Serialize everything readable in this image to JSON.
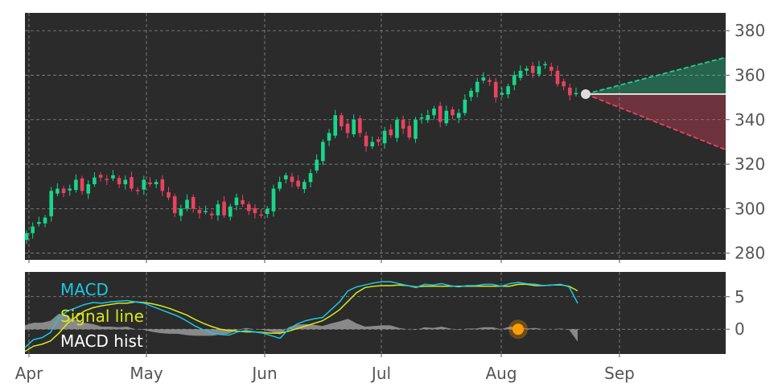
{
  "colors": {
    "background": "#ffffff",
    "panel": "#2b2b2b",
    "grid": "#8a8a8a",
    "up": "#17d68c",
    "down": "#e8435f",
    "macd": "#19c7e6",
    "signal": "#d7e81d",
    "hist": "#9a9a9a",
    "marker": "#ff9c00",
    "projection_up": "#1fcf8f",
    "projection_down": "#e8435f",
    "last_close_dot": "#dddddd",
    "tick_text": "#555555"
  },
  "chart_data": [
    {
      "type": "candlestick",
      "title": "",
      "x_ticks": [
        "Apr",
        "May",
        "Jun",
        "Jul",
        "Aug",
        "Sep"
      ],
      "y_ticks": [
        280,
        300,
        320,
        340,
        360,
        380
      ],
      "ylim": [
        277,
        388
      ],
      "grid": true,
      "y_axis_side": "right",
      "last_close": 351.5,
      "projection": {
        "upper_end": 368,
        "lower_end": 326.5
      },
      "closes": [
        289,
        292,
        294,
        296,
        308,
        309,
        307,
        309,
        313,
        308,
        311,
        314,
        314,
        313,
        315,
        311,
        313,
        309,
        308,
        313,
        311,
        312,
        308,
        305,
        298,
        300,
        304,
        300,
        298,
        299,
        297,
        302,
        297,
        301,
        305,
        302,
        299,
        298,
        297,
        300,
        309,
        312,
        315,
        312,
        310,
        312,
        316,
        322,
        330,
        334,
        342,
        337,
        334,
        340,
        334,
        328,
        330,
        330,
        335,
        333,
        340,
        336,
        332,
        340,
        341,
        342,
        345,
        339,
        344,
        342,
        343,
        349,
        353,
        357,
        359,
        357,
        350,
        352,
        355,
        360,
        362,
        363,
        361,
        364,
        365,
        362,
        356,
        355,
        351,
        352
      ]
    },
    {
      "type": "line",
      "y_ticks": [
        0,
        5
      ],
      "ylim": [
        -3.8,
        8.8
      ],
      "series": [
        {
          "name": "MACD",
          "values": [
            -2.8,
            -1.6,
            -1.3,
            -0.5,
            1.8,
            2.8,
            3.3,
            3.8,
            4.1,
            4.0,
            4.2,
            4.3,
            4.4,
            4.2,
            4.0,
            3.5,
            3.0,
            2.5,
            2.0,
            1.3,
            0.5,
            -0.1,
            -0.6,
            -0.8,
            -0.9,
            -0.4,
            -0.2,
            -0.4,
            -0.6,
            -1.0,
            -1.4,
            0.0,
            0.8,
            1.3,
            1.6,
            1.8,
            3.0,
            4.2,
            5.9,
            6.5,
            6.8,
            7.1,
            7.3,
            7.3,
            7.0,
            6.7,
            6.4,
            6.9,
            6.8,
            7.0,
            6.7,
            6.5,
            6.7,
            6.7,
            6.9,
            6.9,
            6.6,
            7.0,
            7.2,
            7.0,
            6.9,
            6.7,
            6.8,
            6.9,
            6.5,
            4.0
          ]
        },
        {
          "name": "Signal line",
          "values": [
            -3.4,
            -2.6,
            -2.3,
            -1.8,
            -0.6,
            0.9,
            1.9,
            2.8,
            3.3,
            3.6,
            3.8,
            4.0,
            4.0,
            4.2,
            4.1,
            3.9,
            3.6,
            3.2,
            2.7,
            2.2,
            1.5,
            0.9,
            0.4,
            0.0,
            -0.2,
            -0.3,
            -0.4,
            -0.4,
            -0.5,
            -0.6,
            -0.6,
            -0.3,
            0.1,
            0.5,
            0.9,
            1.3,
            2.1,
            3.0,
            4.3,
            5.6,
            6.4,
            6.6,
            6.7,
            6.7,
            6.8,
            6.7,
            6.5,
            6.6,
            6.6,
            6.6,
            6.6,
            6.6,
            6.6,
            6.6,
            6.6,
            6.6,
            6.6,
            6.6,
            6.9,
            6.9,
            6.7,
            6.7,
            6.8,
            6.8,
            6.6,
            5.9
          ]
        },
        {
          "name": "MACD hist",
          "kind": "area",
          "values": [
            0.6,
            1.0,
            1.0,
            1.3,
            2.4,
            1.9,
            1.4,
            1.0,
            0.8,
            0.4,
            0.4,
            0.3,
            0.4,
            0.0,
            -0.1,
            -0.4,
            -0.6,
            -0.7,
            -0.7,
            -0.9,
            -1.0,
            -1.0,
            -1.0,
            -0.8,
            -0.7,
            -0.1,
            0.2,
            0.0,
            -0.1,
            -0.4,
            -0.8,
            0.3,
            0.7,
            0.8,
            0.7,
            0.5,
            0.9,
            1.2,
            1.6,
            0.9,
            0.4,
            0.5,
            0.6,
            0.6,
            0.2,
            0.0,
            -0.1,
            0.3,
            0.2,
            0.4,
            0.1,
            -0.1,
            0.1,
            0.1,
            0.3,
            0.3,
            0.0,
            0.4,
            0.3,
            0.1,
            0.2,
            0.0,
            0.0,
            0.1,
            -0.1,
            -1.9
          ]
        }
      ],
      "marker": {
        "index": 58,
        "value": 0.0
      }
    }
  ]
}
